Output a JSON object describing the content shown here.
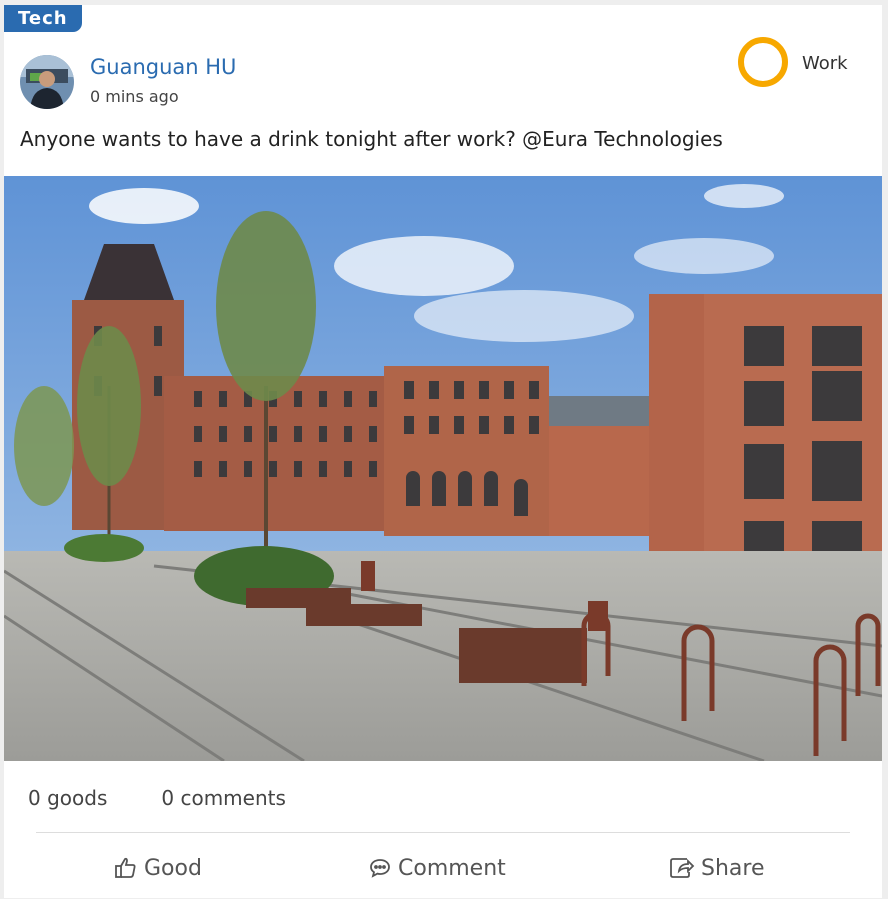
{
  "post": {
    "category_tag": "Tech",
    "author": "Guanguan HU",
    "time": "0 mins ago",
    "category": "Work",
    "text": "Anyone wants to have a drink tonight after work? @Eura Technologies"
  },
  "stats": {
    "goods": "0 goods",
    "comments": "0 comments"
  },
  "actions": {
    "good": "Good",
    "comment": "Comment",
    "share": "Share"
  },
  "colors": {
    "accent": "#2a6bb0",
    "category_ring": "#f7a800"
  },
  "icons": [
    "thumbs-up-icon",
    "comment-icon",
    "share-icon"
  ]
}
